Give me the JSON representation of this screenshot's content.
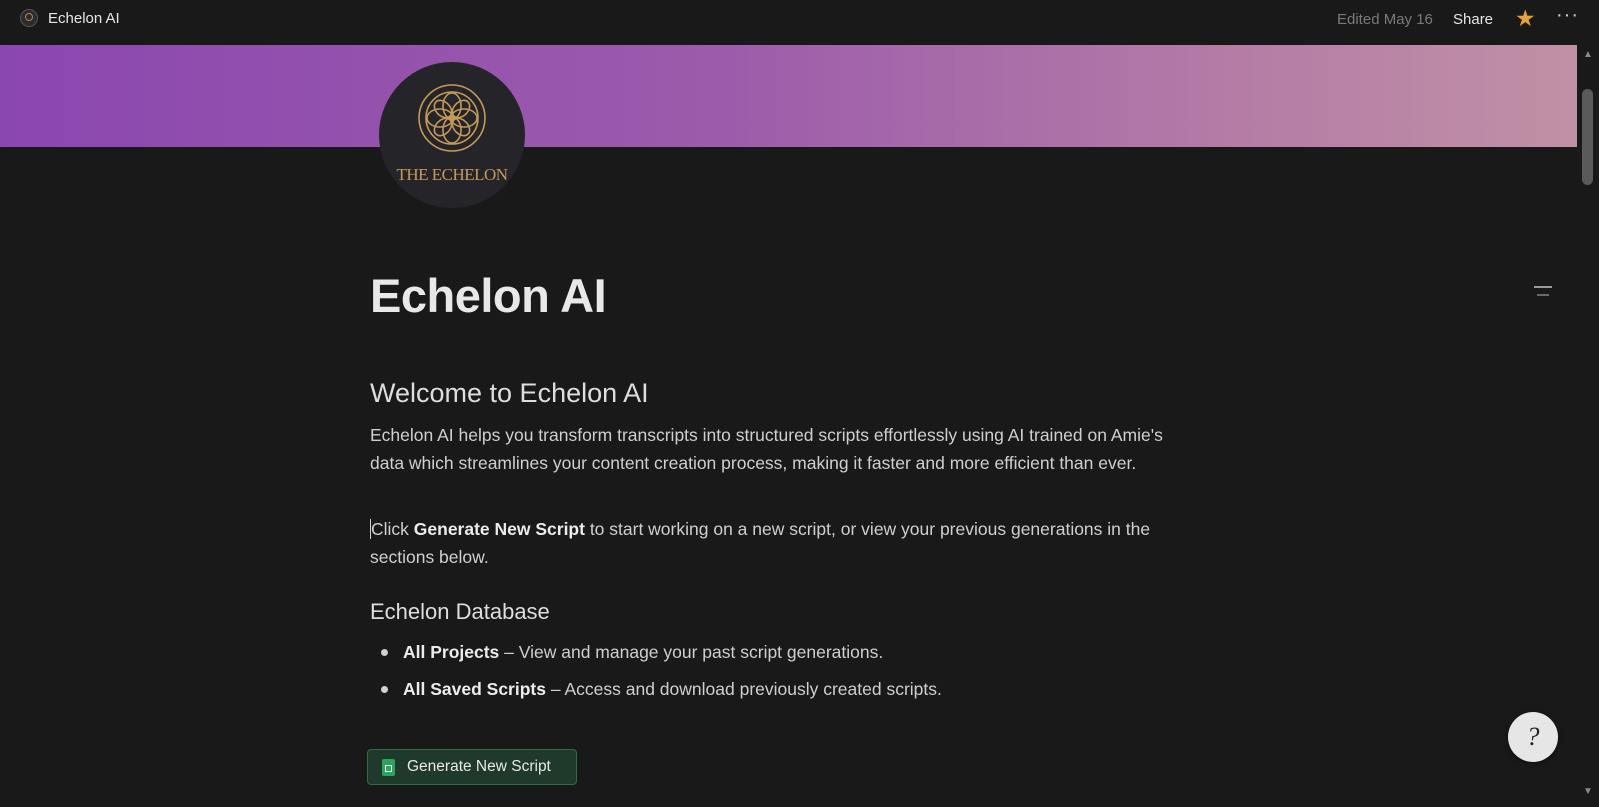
{
  "header": {
    "app_title": "Echelon AI",
    "edited": "Edited May 16",
    "share_label": "Share",
    "more_label": "···",
    "colors": {
      "favorite_star": "#e3a23d"
    }
  },
  "cover": {
    "gradient_start": "#8b47b0",
    "gradient_end": "#c090a5",
    "logo_text": "THE ECHELON"
  },
  "page": {
    "title": "Echelon AI",
    "welcome_heading": "Welcome to Echelon AI",
    "intro": "Echelon AI helps you transform transcripts into structured scripts effortlessly using AI trained on Amie's data which streamlines your content creation process, making it faster and more efficient than ever.",
    "instruction": {
      "prefix": "Click ",
      "bold": "Generate New Script",
      "suffix": " to start working on a new script, or view your previous generations in the sections below."
    },
    "database_heading": "Echelon Database",
    "database_items": [
      {
        "bold": "All Projects",
        "text": " – View and manage your past script generations."
      },
      {
        "bold": "All Saved Scripts",
        "text": " – Access and download previously created scripts."
      }
    ],
    "generate_button": "Generate New Script"
  },
  "help_button": {
    "label": "?"
  }
}
